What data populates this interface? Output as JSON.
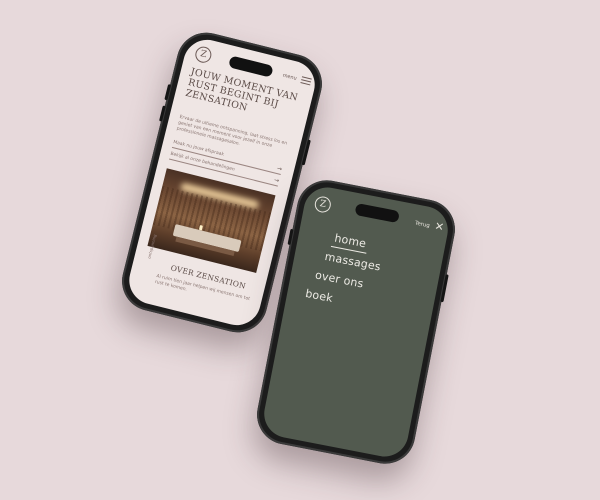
{
  "phone_left": {
    "logo": "Z",
    "menu_label": "menu",
    "hero_title": "JOUW MOMENT VAN RUST BEGINT BIJ ZENSATION",
    "hero_text": "Ervaar de ultieme ontspanning, laat stress los en geniet van een moment voor jezelf in onze professionele massagesalon.",
    "row1": "Maak nu jouw afspraak",
    "row2": "Bekijk al onze behandelingen",
    "rot_text": "ontspanning",
    "section_title": "OVER ZENSATION",
    "section_text": "Al ruim tien jaar helpen wij mensen om tot rust te komen."
  },
  "phone_right": {
    "logo": "Z",
    "back_label": "Terug",
    "close_glyph": "✕",
    "nav": [
      "home",
      "massages",
      "over ons",
      "boek"
    ]
  }
}
